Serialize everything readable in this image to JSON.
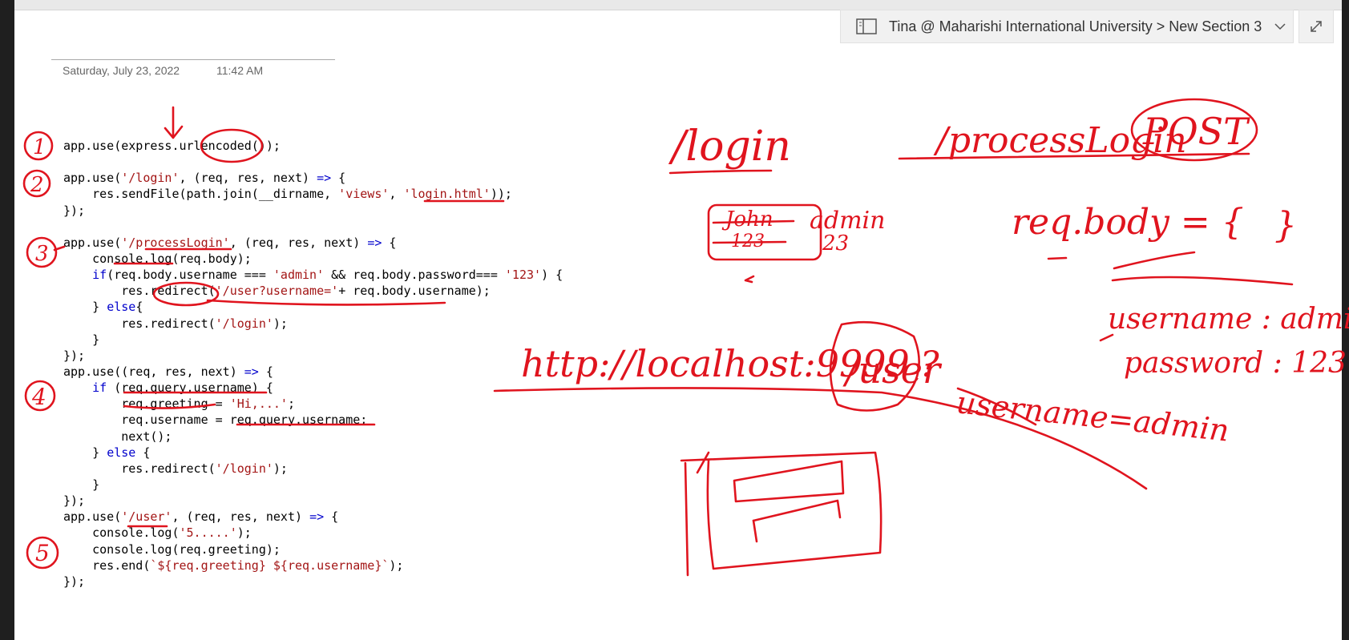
{
  "app": {
    "notebook_path": "Tina @ Maharishi International University > New Section 3",
    "icons": {
      "notebook": "notebook-icon",
      "chevron": "chevron-down-icon",
      "expand": "expand-icon"
    }
  },
  "page": {
    "date": "Saturday, July 23, 2022",
    "time": "11:42 AM"
  },
  "code_lines": [
    "app.use(express.urlencoded());",
    "",
    "app.use('/login', (req, res, next) => {",
    "    res.sendFile(path.join(__dirname, 'views', 'login.html'));",
    "});",
    "",
    "app.use('/processLogin', (req, res, next) => {",
    "    console.log(req.body);",
    "    if(req.body.username === 'admin' && req.body.password=== '123') {",
    "        res.redirect('/user?username='+ req.body.username);",
    "    } else{",
    "        res.redirect('/login');",
    "    }",
    "});",
    "app.use((req, res, next) => {",
    "    if (req.query.username) {",
    "        req.greeting = 'Hi,...';",
    "        req.username = req.query.username;",
    "        next();",
    "    } else {",
    "        res.redirect('/login');",
    "    }",
    "});",
    "app.use('/user', (req, res, next) => {",
    "    console.log('5.....');",
    "    console.log(req.greeting);",
    "    res.end(`${req.greeting} ${req.username}`);",
    "});"
  ],
  "ink": {
    "color": "#e0141e",
    "step_numbers": [
      "1",
      "2",
      "3",
      "4",
      "5"
    ],
    "login_route": "/login",
    "process_route": "/processLogin",
    "method": "POST",
    "struck_user": "John",
    "struck_pass": "123",
    "admin": "admin",
    "pass_short": "23",
    "req_body": "req.body = {",
    "close_brace": "}",
    "username_line": "username : admin",
    "password_line": "password : 123",
    "url_base": "http://localhost:9999",
    "url_path": "/user",
    "url_q": "?",
    "query_string": "username=admin"
  }
}
